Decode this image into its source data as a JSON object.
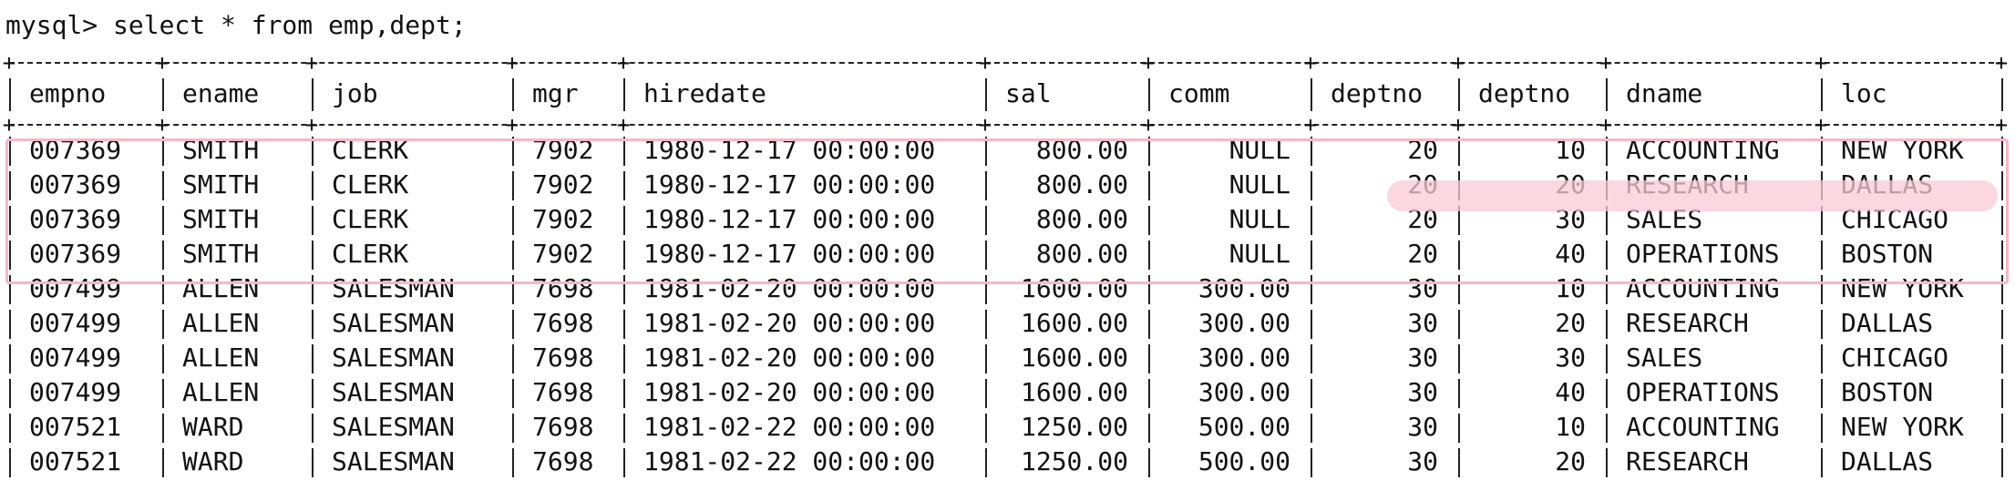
{
  "terminal": {
    "prompt": "mysql> select * from emp,dept;"
  },
  "table": {
    "columns": [
      "empno",
      "ename",
      "job",
      "mgr",
      "hiredate",
      "sal",
      "comm",
      "deptno",
      "deptno",
      "dname",
      "loc"
    ],
    "rows": [
      [
        "007369",
        "SMITH",
        "CLERK",
        "7902",
        "1980-12-17 00:00:00",
        "800.00",
        "NULL",
        "20",
        "10",
        "ACCOUNTING",
        "NEW YORK"
      ],
      [
        "007369",
        "SMITH",
        "CLERK",
        "7902",
        "1980-12-17 00:00:00",
        "800.00",
        "NULL",
        "20",
        "20",
        "RESEARCH",
        "DALLAS"
      ],
      [
        "007369",
        "SMITH",
        "CLERK",
        "7902",
        "1980-12-17 00:00:00",
        "800.00",
        "NULL",
        "20",
        "30",
        "SALES",
        "CHICAGO"
      ],
      [
        "007369",
        "SMITH",
        "CLERK",
        "7902",
        "1980-12-17 00:00:00",
        "800.00",
        "NULL",
        "20",
        "40",
        "OPERATIONS",
        "BOSTON"
      ],
      [
        "007499",
        "ALLEN",
        "SALESMAN",
        "7698",
        "1981-02-20 00:00:00",
        "1600.00",
        "300.00",
        "30",
        "10",
        "ACCOUNTING",
        "NEW YORK"
      ],
      [
        "007499",
        "ALLEN",
        "SALESMAN",
        "7698",
        "1981-02-20 00:00:00",
        "1600.00",
        "300.00",
        "30",
        "20",
        "RESEARCH",
        "DALLAS"
      ],
      [
        "007499",
        "ALLEN",
        "SALESMAN",
        "7698",
        "1981-02-20 00:00:00",
        "1600.00",
        "300.00",
        "30",
        "30",
        "SALES",
        "CHICAGO"
      ],
      [
        "007499",
        "ALLEN",
        "SALESMAN",
        "7698",
        "1981-02-20 00:00:00",
        "1600.00",
        "300.00",
        "30",
        "40",
        "OPERATIONS",
        "BOSTON"
      ],
      [
        "007521",
        "WARD",
        "SALESMAN",
        "7698",
        "1981-02-22 00:00:00",
        "1250.00",
        "500.00",
        "30",
        "10",
        "ACCOUNTING",
        "NEW YORK"
      ],
      [
        "007521",
        "WARD",
        "SALESMAN",
        "7698",
        "1981-02-22 00:00:00",
        "1250.00",
        "500.00",
        "30",
        "20",
        "RESEARCH",
        "DALLAS"
      ]
    ]
  },
  "annotation": {
    "box_color": "#f7b6c8",
    "pill_color": "#f9c9d8"
  }
}
